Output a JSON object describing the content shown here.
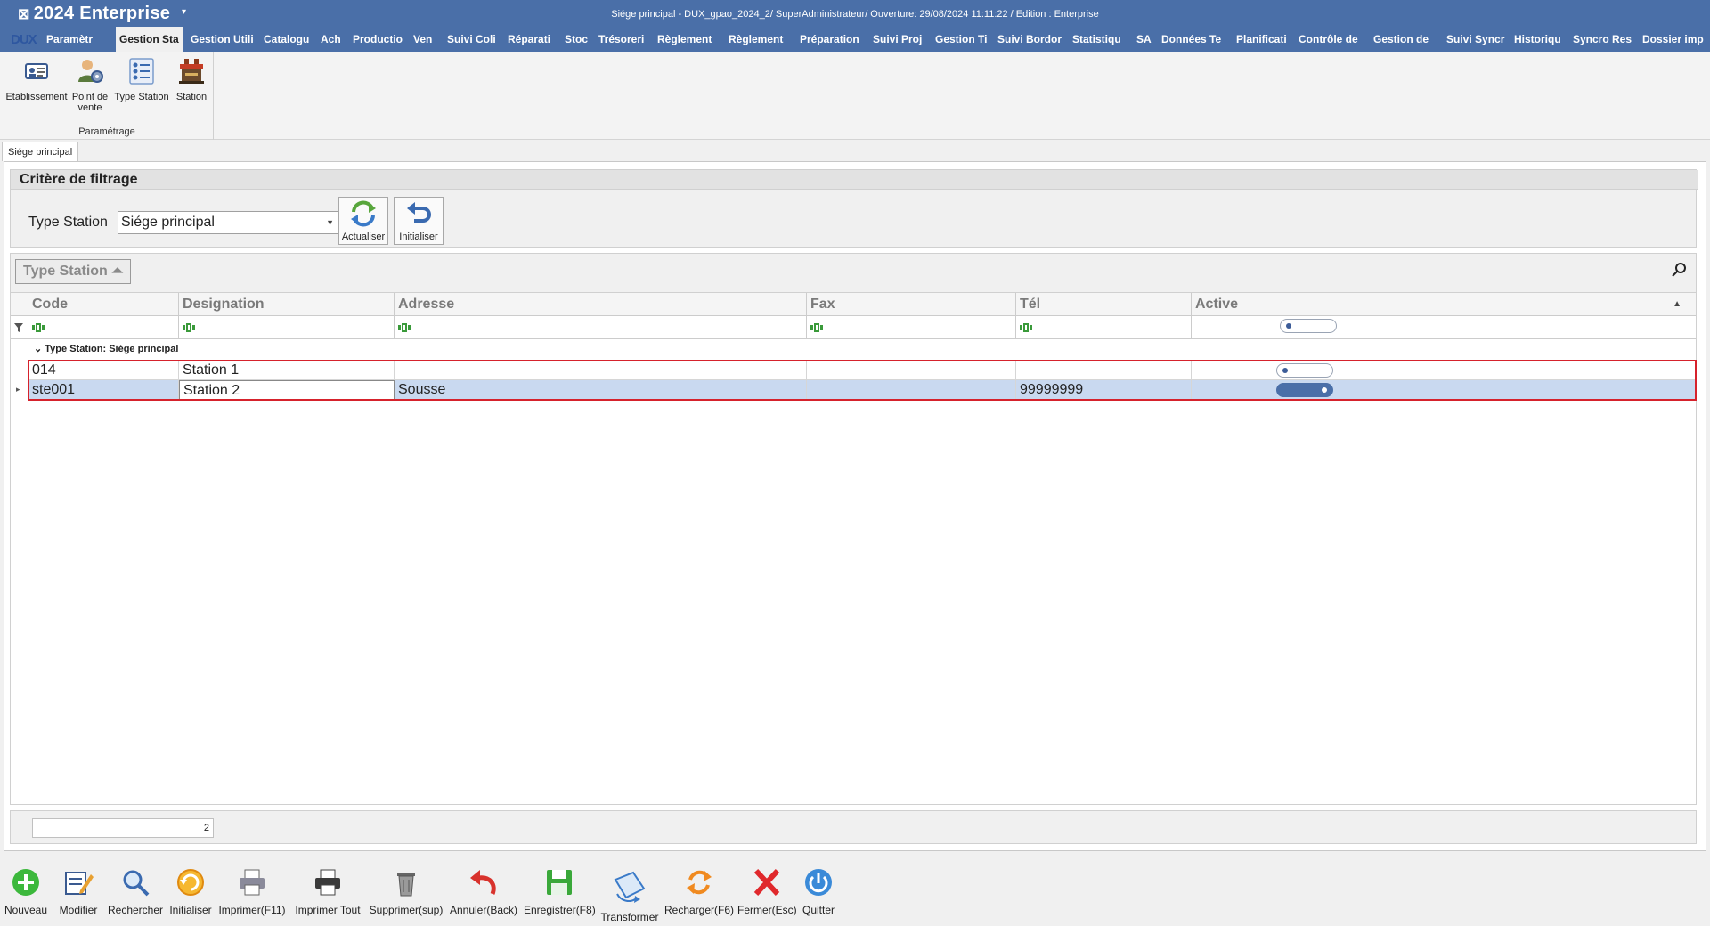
{
  "titlebar": {
    "app_name": "2024  Enterprise",
    "window_info": "Siége principal - DUX_gpao_2024_2/ SuperAdministrateur/ Ouverture: 29/08/2024 11:11:22 / Edition : Enterprise"
  },
  "menu": {
    "logo": "DUX",
    "items": [
      {
        "label": "Paramètr"
      },
      {
        "label": "Gestion Sta"
      },
      {
        "label": "Gestion Utili"
      },
      {
        "label": "Catalogu"
      },
      {
        "label": "Ach"
      },
      {
        "label": "Productio"
      },
      {
        "label": "Ven"
      },
      {
        "label": "Suivi Coli"
      },
      {
        "label": "Réparati"
      },
      {
        "label": "Stoc"
      },
      {
        "label": "Trésoreri"
      },
      {
        "label": "Règlement"
      },
      {
        "label": "Règlement"
      },
      {
        "label": "Préparation"
      },
      {
        "label": "Suivi Proj"
      },
      {
        "label": "Gestion Ti"
      },
      {
        "label": "Suivi Bordor"
      },
      {
        "label": "Statistiqu"
      },
      {
        "label": "SA"
      },
      {
        "label": "Données Te"
      },
      {
        "label": "Planificati"
      },
      {
        "label": "Contrôle de"
      },
      {
        "label": "Gestion de"
      },
      {
        "label": "Suivi Syncr"
      },
      {
        "label": "Historiqu"
      },
      {
        "label": "Syncro Res"
      },
      {
        "label": "Dossier imp"
      }
    ],
    "active_index": 1
  },
  "ribbon": {
    "buttons": [
      {
        "label": "Etablissement",
        "icon": "id-card-icon"
      },
      {
        "label": "Point de vente",
        "icon": "user-gear-icon"
      },
      {
        "label": "Type Station",
        "icon": "list-icon"
      },
      {
        "label": "Station",
        "icon": "station-icon"
      }
    ],
    "group_label": "Paramétrage"
  },
  "doc_tab": "Siége principal",
  "filter": {
    "title": "Critère de filtrage",
    "label": "Type Station",
    "value": "Siége principal",
    "refresh_label": "Actualiser",
    "reset_label": "Initialiser"
  },
  "grid": {
    "groupby_chip": "Type Station",
    "columns": [
      "Code",
      "Designation",
      "Adresse",
      "Fax",
      "Tél",
      "Active"
    ],
    "group_row": "Type Station: Siége principal",
    "rows": [
      {
        "code": "014",
        "designation": "Station 1",
        "adresse": "",
        "fax": "",
        "tel": "",
        "active": false
      },
      {
        "code": "ste001",
        "designation": "Station 2",
        "adresse": "Sousse",
        "fax": "",
        "tel": "99999999",
        "active": true
      }
    ],
    "record_count": "2"
  },
  "toolbar": {
    "buttons": [
      {
        "label": "Nouveau",
        "icon": "add-icon"
      },
      {
        "label": "Modifier",
        "icon": "edit-icon"
      },
      {
        "label": "Rechercher",
        "icon": "search-icon"
      },
      {
        "label": "Initialiser",
        "icon": "reset-icon"
      },
      {
        "label": "Imprimer(F11)",
        "icon": "print-icon"
      },
      {
        "label": "Imprimer Tout",
        "icon": "print-all-icon"
      },
      {
        "label": "Supprimer(sup)",
        "icon": "trash-icon"
      },
      {
        "label": "Annuler(Back)",
        "icon": "undo-icon"
      },
      {
        "label": "Enregistrer(F8)",
        "icon": "save-icon"
      },
      {
        "label": "Transformer",
        "icon": "transform-icon"
      },
      {
        "label": "Recharger(F6)",
        "icon": "reload-icon"
      },
      {
        "label": "Fermer(Esc)",
        "icon": "close-icon"
      },
      {
        "label": "Quitter",
        "icon": "power-icon"
      }
    ]
  }
}
